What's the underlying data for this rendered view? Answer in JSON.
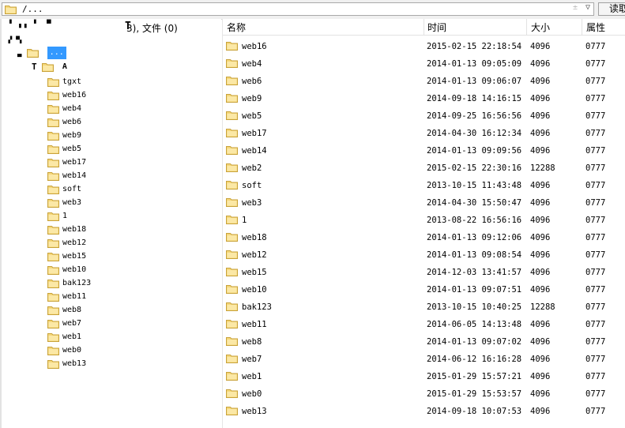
{
  "address": {
    "path": "/..."
  },
  "toolbar": {
    "read_label": "读取"
  },
  "left": {
    "status": "3), 文件 (0)",
    "root_label": "...",
    "sub_label": "A",
    "tree": [
      "tgxt",
      "web16",
      "web4",
      "web6",
      "web9",
      "web5",
      "web17",
      "web14",
      "soft",
      "web3",
      "1",
      "web18",
      "web12",
      "web15",
      "web10",
      "bak123",
      "web11",
      "web8",
      "web7",
      "web1",
      "web0",
      "web13"
    ]
  },
  "columns": {
    "name": "名称",
    "time": "时间",
    "size": "大小",
    "attr": "属性"
  },
  "files": [
    {
      "name": "web16",
      "time": "2015-02-15 22:18:54",
      "size": "4096",
      "attr": "0777"
    },
    {
      "name": "web4",
      "time": "2014-01-13 09:05:09",
      "size": "4096",
      "attr": "0777"
    },
    {
      "name": "web6",
      "time": "2014-01-13 09:06:07",
      "size": "4096",
      "attr": "0777"
    },
    {
      "name": "web9",
      "time": "2014-09-18 14:16:15",
      "size": "4096",
      "attr": "0777"
    },
    {
      "name": "web5",
      "time": "2014-09-25 16:56:56",
      "size": "4096",
      "attr": "0777"
    },
    {
      "name": "web17",
      "time": "2014-04-30 16:12:34",
      "size": "4096",
      "attr": "0777"
    },
    {
      "name": "web14",
      "time": "2014-01-13 09:09:56",
      "size": "4096",
      "attr": "0777"
    },
    {
      "name": "web2",
      "time": "2015-02-15 22:30:16",
      "size": "12288",
      "attr": "0777"
    },
    {
      "name": "soft",
      "time": "2013-10-15 11:43:48",
      "size": "4096",
      "attr": "0777"
    },
    {
      "name": "web3",
      "time": "2014-04-30 15:50:47",
      "size": "4096",
      "attr": "0777"
    },
    {
      "name": "1",
      "time": "2013-08-22 16:56:16",
      "size": "4096",
      "attr": "0777"
    },
    {
      "name": "web18",
      "time": "2014-01-13 09:12:06",
      "size": "4096",
      "attr": "0777"
    },
    {
      "name": "web12",
      "time": "2014-01-13 09:08:54",
      "size": "4096",
      "attr": "0777"
    },
    {
      "name": "web15",
      "time": "2014-12-03 13:41:57",
      "size": "4096",
      "attr": "0777"
    },
    {
      "name": "web10",
      "time": "2014-01-13 09:07:51",
      "size": "4096",
      "attr": "0777"
    },
    {
      "name": "bak123",
      "time": "2013-10-15 10:40:25",
      "size": "12288",
      "attr": "0777"
    },
    {
      "name": "web11",
      "time": "2014-06-05 14:13:48",
      "size": "4096",
      "attr": "0777"
    },
    {
      "name": "web8",
      "time": "2014-01-13 09:07:02",
      "size": "4096",
      "attr": "0777"
    },
    {
      "name": "web7",
      "time": "2014-06-12 16:16:28",
      "size": "4096",
      "attr": "0777"
    },
    {
      "name": "web1",
      "time": "2015-01-29 15:57:21",
      "size": "4096",
      "attr": "0777"
    },
    {
      "name": "web0",
      "time": "2015-01-29 15:53:57",
      "size": "4096",
      "attr": "0777"
    },
    {
      "name": "web13",
      "time": "2014-09-18 10:07:53",
      "size": "4096",
      "attr": "0777"
    }
  ],
  "colors": {
    "folder_fill": "#f5d77a",
    "folder_stroke": "#c8a23a",
    "selection": "#3399ff"
  }
}
